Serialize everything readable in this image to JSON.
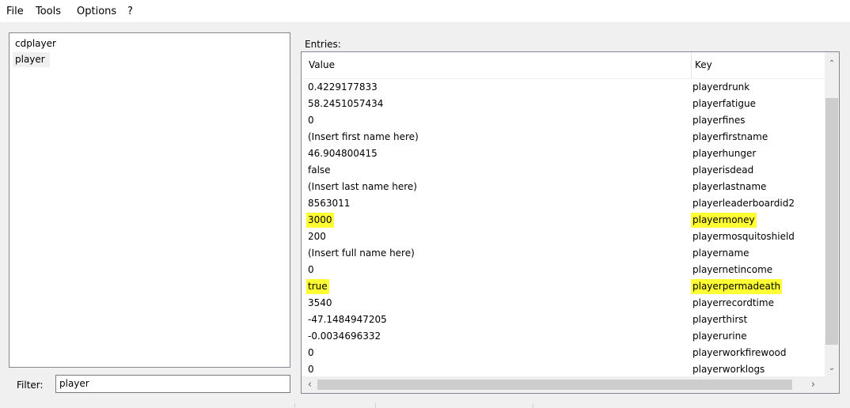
{
  "menu": [
    "File",
    "Tools",
    "Options",
    "?"
  ],
  "left_list": {
    "items": [
      "cdplayer",
      "player"
    ],
    "selected": "player"
  },
  "filter": {
    "label": "Filter:",
    "value": "player"
  },
  "entries": {
    "label": "Entries:",
    "columns": {
      "value": "Value",
      "key": "Key"
    },
    "rows": [
      {
        "value": "0.4229177833",
        "key": "playerdrunk",
        "highlight": false
      },
      {
        "value": "58.2451057434",
        "key": "playerfatigue",
        "highlight": false
      },
      {
        "value": "0",
        "key": "playerfines",
        "highlight": false
      },
      {
        "value": "(Insert first name here)",
        "key": "playerfirstname",
        "highlight": false
      },
      {
        "value": "46.904800415",
        "key": "playerhunger",
        "highlight": false
      },
      {
        "value": "false",
        "key": "playerisdead",
        "highlight": false
      },
      {
        "value": "(Insert last name here)",
        "key": "playerlastname",
        "highlight": false
      },
      {
        "value": "8563011",
        "key": "playerleaderboardid2",
        "highlight": false
      },
      {
        "value": "3000",
        "key": "playermoney",
        "highlight": true
      },
      {
        "value": "200",
        "key": "playermosquitoshield",
        "highlight": false
      },
      {
        "value": "(Insert full name here)",
        "key": "playername",
        "highlight": false
      },
      {
        "value": "0",
        "key": "playernetincome",
        "highlight": false
      },
      {
        "value": "true",
        "key": "playerpermadeath",
        "highlight": true
      },
      {
        "value": "3540",
        "key": "playerrecordtime",
        "highlight": false
      },
      {
        "value": "-47.1484947205",
        "key": "playerthirst",
        "highlight": false
      },
      {
        "value": "-0.0034696332",
        "key": "playerurine",
        "highlight": false
      },
      {
        "value": "0",
        "key": "playerworkfirewood",
        "highlight": false
      },
      {
        "value": "0",
        "key": "playerworklogs",
        "highlight": false
      }
    ]
  },
  "colors": {
    "highlight": "#ffff33",
    "selection": "#f0f0f0"
  }
}
